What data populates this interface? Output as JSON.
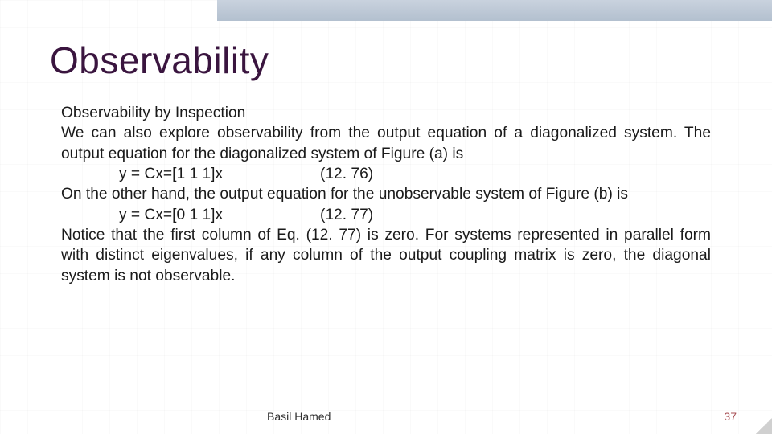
{
  "title": "Observability",
  "subtitle": "Observability by Inspection",
  "para1": "We can also explore observability from the output equation of a diagonalized system. The output equation for the diagonalized system of Figure (a) is",
  "eq1": {
    "lhs": "y = Cx=[1 1 1]x",
    "num": "(12. 76)"
  },
  "para2": "On the other hand, the output equation for the unobservable system of Figure (b) is",
  "eq2": {
    "lhs": "y = Cx=[0 1 1]x",
    "num": "(12. 77)"
  },
  "para3": "Notice that the first column of Eq. (12. 77) is zero. For systems represented in parallel form with distinct eigenvalues, if any column of the output coupling matrix is zero, the diagonal system is not observable.",
  "footer": {
    "author": "Basil Hamed",
    "page": "37"
  }
}
